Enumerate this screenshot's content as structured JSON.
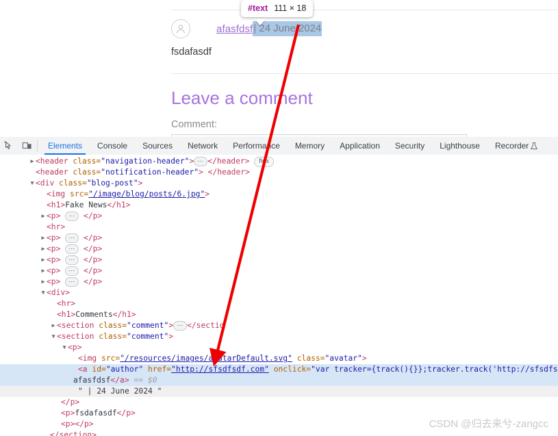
{
  "page": {
    "author_name": "afasfdsf",
    "date_text": "| 24 June 2024",
    "comment_body": "fsdafasdf",
    "leave_comment_heading": "Leave a comment",
    "comment_field_label": "Comment:"
  },
  "tooltip": {
    "node_label": "#text",
    "dimensions": "111 × 18"
  },
  "devtools": {
    "icons": {
      "inspect": "inspect-cursor-icon",
      "device": "device-toolbar-icon",
      "recorder": "recorder-flask-icon"
    },
    "tabs": [
      {
        "label": "Elements",
        "active": true
      },
      {
        "label": "Console",
        "active": false
      },
      {
        "label": "Sources",
        "active": false
      },
      {
        "label": "Network",
        "active": false
      },
      {
        "label": "Performance",
        "active": false
      },
      {
        "label": "Memory",
        "active": false
      },
      {
        "label": "Application",
        "active": false
      },
      {
        "label": "Security",
        "active": false
      },
      {
        "label": "Lighthouse",
        "active": false
      },
      {
        "label": "Recorder",
        "active": false
      }
    ]
  },
  "dom": {
    "lines": [
      {
        "id": "l01",
        "tag_open": "<header",
        "attr": " class=",
        "val": "\"navigation-header\"",
        "close": ">",
        "tag_end": "</header>",
        "badge": "flex"
      },
      {
        "id": "l02",
        "tag_open": "<header",
        "attr": " class=",
        "val": "\"notification-header\"",
        "close": ">",
        "tag_end": "</header>"
      },
      {
        "id": "l03",
        "tag_open": "<div",
        "attr": " class=",
        "val": "\"blog-post\"",
        "close": ">"
      },
      {
        "id": "l04",
        "tag_open": "<img",
        "attr": " src=",
        "val": "\"/image/blog/posts/6.jpg\"",
        "close": ">"
      },
      {
        "id": "l05",
        "tag_open": "<h1>",
        "text": "Fake News",
        "tag_end": "</h1>"
      },
      {
        "id": "l06",
        "tag_open": "<p>",
        "tag_end": "</p>"
      },
      {
        "id": "l07",
        "tag_open": "<hr>"
      },
      {
        "id": "l08",
        "tag_open": "<p>",
        "tag_end": "</p>"
      },
      {
        "id": "l09",
        "tag_open": "<p>",
        "tag_end": "</p>"
      },
      {
        "id": "l10",
        "tag_open": "<p>",
        "tag_end": "</p>"
      },
      {
        "id": "l11",
        "tag_open": "<p>",
        "tag_end": "</p>"
      },
      {
        "id": "l12",
        "tag_open": "<p>",
        "tag_end": "</p>"
      },
      {
        "id": "l13",
        "tag_open": "<div>"
      },
      {
        "id": "l14",
        "tag_open": "<hr>"
      },
      {
        "id": "l15",
        "tag_open": "<h1>",
        "text": "Comments",
        "tag_end": "</h1>"
      },
      {
        "id": "l16",
        "tag_open": "<section",
        "attr": " class=",
        "val": "\"comment\"",
        "close": ">",
        "tag_end": "</sectio"
      },
      {
        "id": "l17",
        "tag_open": "<section",
        "attr": " class=",
        "val": "\"comment\"",
        "close": ">"
      },
      {
        "id": "l18",
        "tag_open": "<p>"
      },
      {
        "id": "l19",
        "tag_open": "<img",
        "attr": " src=",
        "val": "\"/resources/images/avatarDefault.svg\"",
        "attr2": " class=",
        "val2": "\"avatar\"",
        "close": ">"
      },
      {
        "id": "l20",
        "tag_open": "<a",
        "attr": " id=",
        "val": "\"author\"",
        "attr2": " href=",
        "val2": "\"http://sfsdfsdf.com\"",
        "attr3": " onclick=",
        "val3": "\"var tracker={track(){}};tracker.track('http://sfsdfsdf.c"
      },
      {
        "id": "l21",
        "text": "afasfdsf",
        "tag_end": "</a>",
        "marker": "== $0"
      },
      {
        "id": "l22",
        "string": "\" | 24 June 2024 \""
      },
      {
        "id": "l23",
        "tag_end": "</p>"
      },
      {
        "id": "l24",
        "tag_open": "<p>",
        "text": "fsdafasdf",
        "tag_end": "</p>"
      },
      {
        "id": "l25",
        "tag_open": "<p>",
        "tag_end": "</p>"
      },
      {
        "id": "l26",
        "tag_end": "</section>"
      }
    ]
  },
  "watermark": {
    "text": "CSDN @归去来兮-zangcc"
  }
}
